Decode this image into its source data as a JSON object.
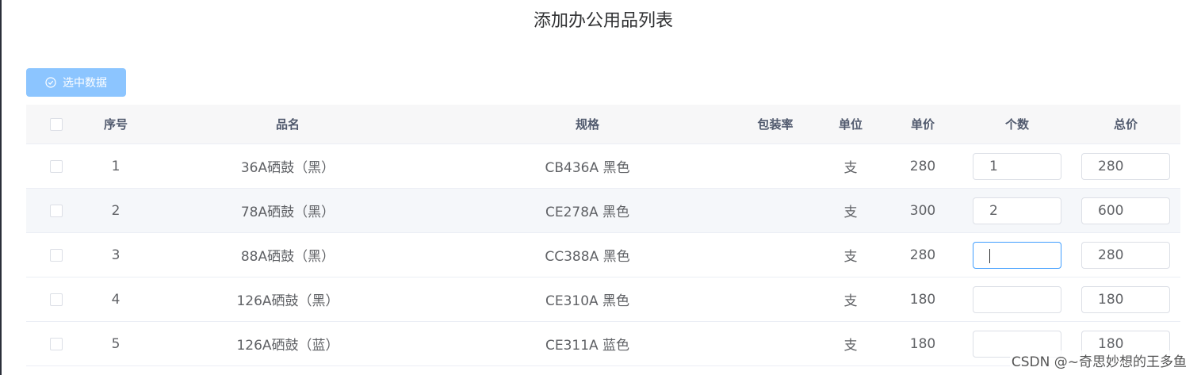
{
  "title": "添加办公用品列表",
  "toolbar": {
    "select_label": "选中数据"
  },
  "columns": {
    "idx": "序号",
    "name": "品名",
    "spec": "规格",
    "pack": "包装率",
    "unit": "单位",
    "price": "单价",
    "qty": "个数",
    "total": "总价"
  },
  "rows": [
    {
      "idx": "1",
      "name": "36A硒鼓（黑）",
      "spec": "CB436A 黑色",
      "pack": "",
      "unit": "支",
      "price": "280",
      "qty": "1",
      "total": "280"
    },
    {
      "idx": "2",
      "name": "78A硒鼓（黑）",
      "spec": "CE278A 黑色",
      "pack": "",
      "unit": "支",
      "price": "300",
      "qty": "2",
      "total": "600"
    },
    {
      "idx": "3",
      "name": "88A硒鼓（黑）",
      "spec": "CC388A 黑色",
      "pack": "",
      "unit": "支",
      "price": "280",
      "qty": "",
      "total": "280"
    },
    {
      "idx": "4",
      "name": "126A硒鼓（黑）",
      "spec": "CE310A 黑色",
      "pack": "",
      "unit": "支",
      "price": "180",
      "qty": "",
      "total": "180"
    },
    {
      "idx": "5",
      "name": "126A硒鼓（蓝）",
      "spec": "CE311A 蓝色",
      "pack": "",
      "unit": "支",
      "price": "180",
      "qty": "",
      "total": "180"
    }
  ],
  "watermark": "CSDN @~奇思妙想的王多鱼",
  "colors": {
    "primary_light": "#8cc5ff",
    "focus": "#409eff",
    "header_bg": "#f7f7f8",
    "stripe_bg": "#f5f7fa"
  },
  "icons": {
    "select_button": "circle-check-icon"
  }
}
